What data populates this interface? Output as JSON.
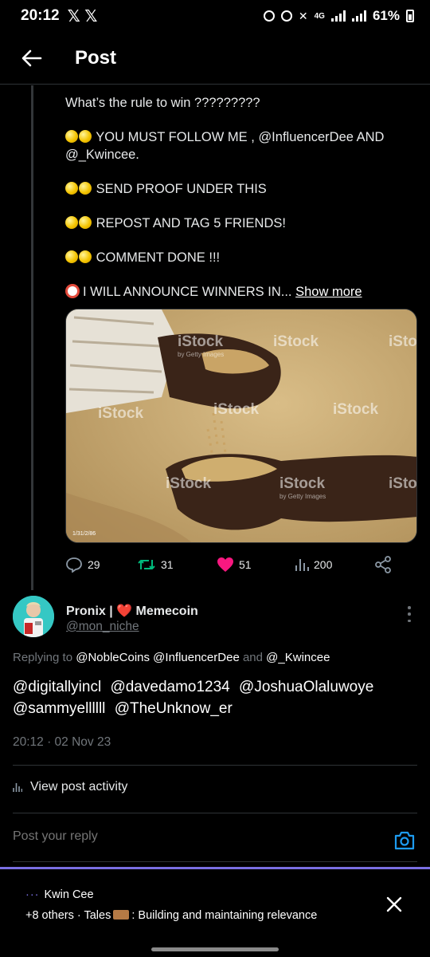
{
  "status_bar": {
    "time": "20:12",
    "x_icons": "𝕏 𝕏",
    "network": "4G",
    "battery": "61%"
  },
  "header": {
    "title": "Post"
  },
  "tweet": {
    "lines": [
      "What’s the rule to win ?????????",
      "YOU MUST FOLLOW ME ,",
      "SEND PROOF UNDER THIS",
      "REPOST AND TAG 5 FRIENDS!",
      "COMMENT DONE !!!",
      "I WILL ANNOUNCE WINNERS  IN..."
    ],
    "mention_1": "@InfluencerDee",
    "and_word": "AND",
    "mention_2": "@_Kwincee",
    "period": ".",
    "show_more": "Show more",
    "media": {
      "watermark": "iStock",
      "watermark_sub": "by Getty Images",
      "caption_stamp": "1/31/2/86"
    },
    "actions": {
      "replies": "29",
      "reposts": "31",
      "likes": "51",
      "views": "200"
    },
    "colors": {
      "repost": "#00ba7c",
      "like": "#f91880"
    }
  },
  "reply": {
    "author_name": "Pronix |",
    "author_heart": "❤️",
    "author_suffix": "Memecoin",
    "handle": "@mon_niche",
    "replying_prefix": "Replying to",
    "replying_to": [
      "@NobleCoins",
      "@InfluencerDee"
    ],
    "replying_and": "and",
    "replying_last": "@_Kwincee",
    "mentions": [
      "@digitallyincl",
      "@davedamo1234",
      "@JoshuaOlaluwoye",
      "@sammyellllll",
      "@TheUnknow_er"
    ],
    "timestamp": "20:12 · 02 Nov 23"
  },
  "view_activity": {
    "label": "View post activity"
  },
  "compose": {
    "placeholder": "Post your reply"
  },
  "banner": {
    "dots": "···",
    "user": "Kwin Cee",
    "prefix": "+8 others · Tales",
    "suffix": ": Building and maintaining relevance",
    "accent": "#7a6fe3"
  }
}
